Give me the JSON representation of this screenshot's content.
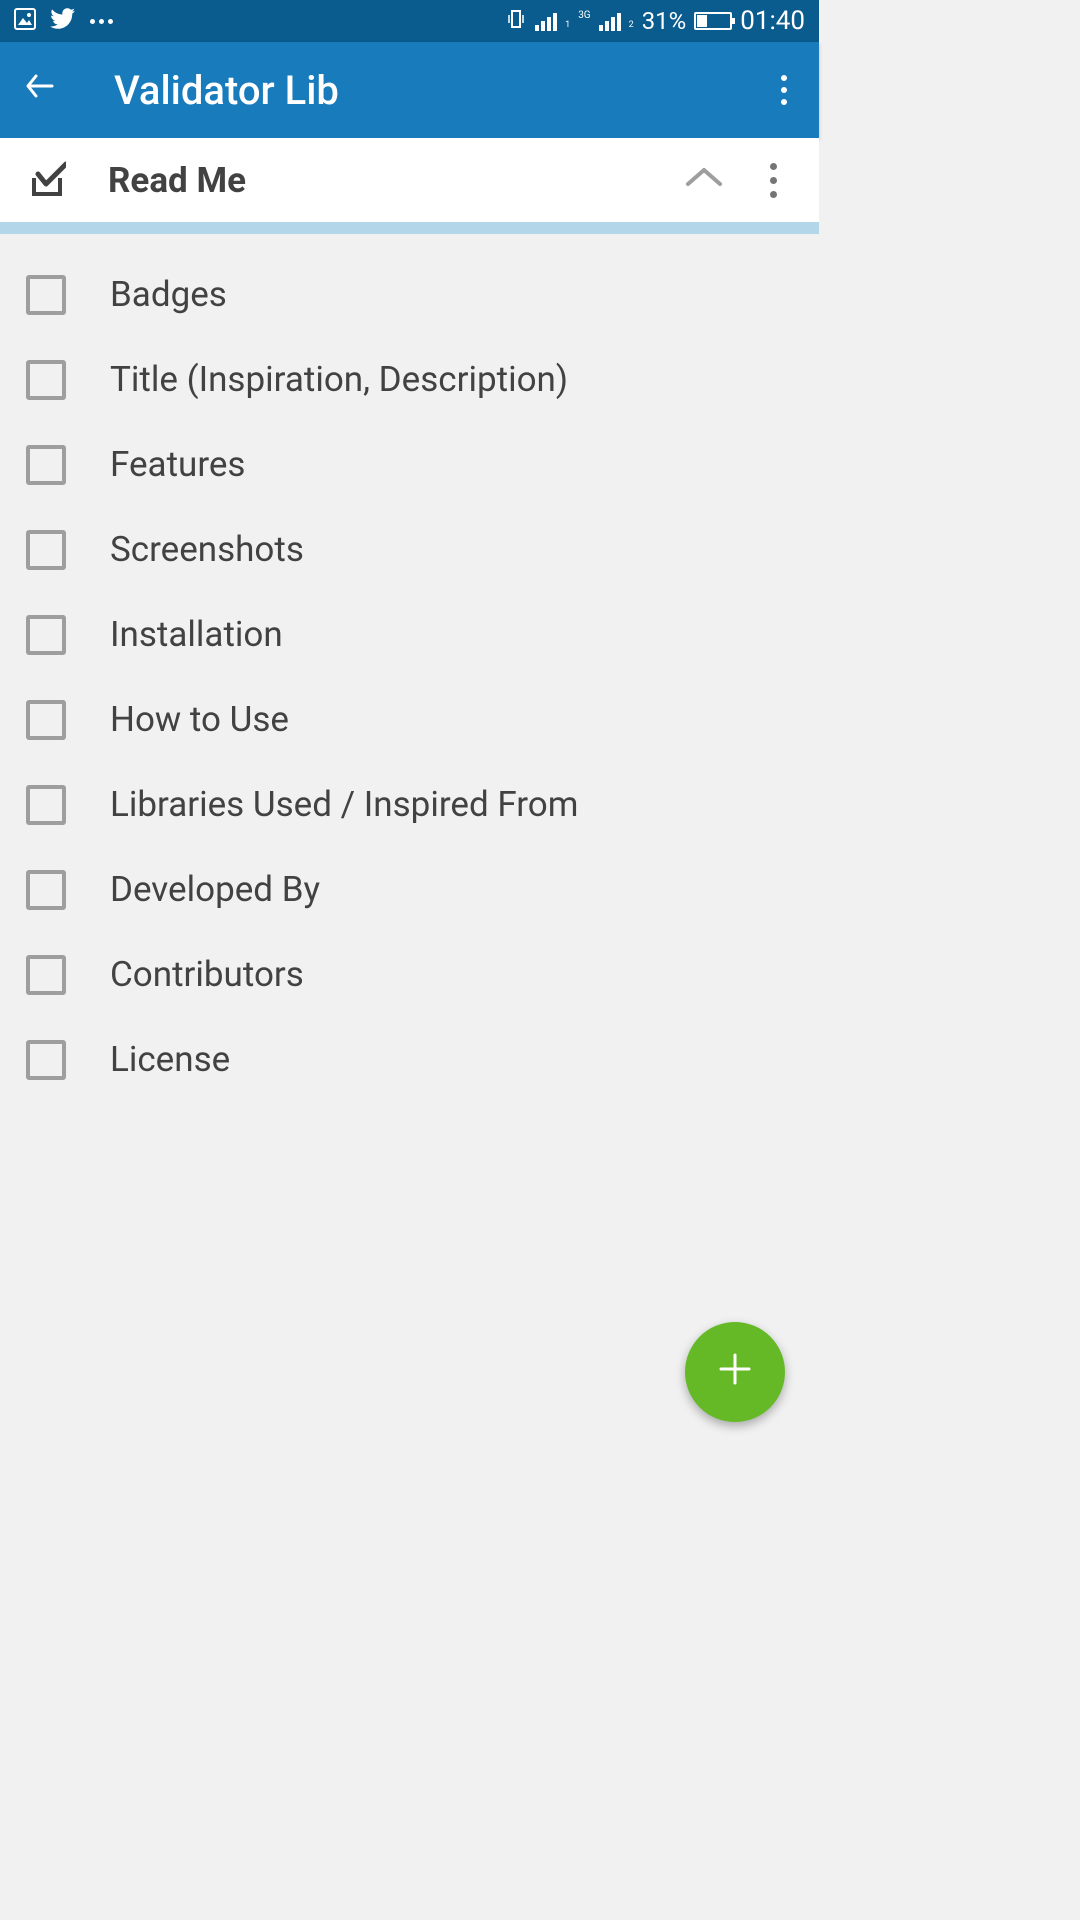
{
  "status": {
    "time": "01:40",
    "battery_pct": "31%",
    "network_label": "3G"
  },
  "app": {
    "title": "Validator Lib"
  },
  "section": {
    "title": "Read Me"
  },
  "items": [
    "Badges",
    "Title (Inspiration, Description)",
    "Features",
    "Screenshots",
    "Installation",
    "How to Use",
    "Libraries Used / Inspired From",
    "Developed By",
    "Contributors",
    "License"
  ]
}
